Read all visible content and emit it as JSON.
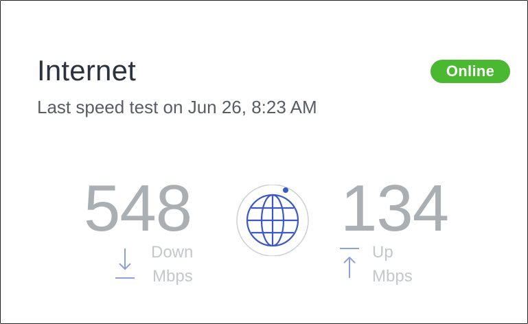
{
  "card": {
    "title": "Internet",
    "subtitle": "Last speed test on Jun 26, 8:23 AM",
    "status_badge": {
      "label": "Online",
      "color": "#4ab830"
    }
  },
  "speed": {
    "download": {
      "value": "548",
      "label": "Down",
      "unit": "Mbps",
      "icon": "arrow-down-icon"
    },
    "upload": {
      "value": "134",
      "label": "Up",
      "unit": "Mbps",
      "icon": "arrow-up-icon"
    },
    "center_icon": "globe-icon"
  },
  "colors": {
    "title": "#2c3340",
    "subtitle": "#575d66",
    "value": "#a9afb2",
    "label": "#c2c8cb",
    "accent": "#3b57c9"
  }
}
